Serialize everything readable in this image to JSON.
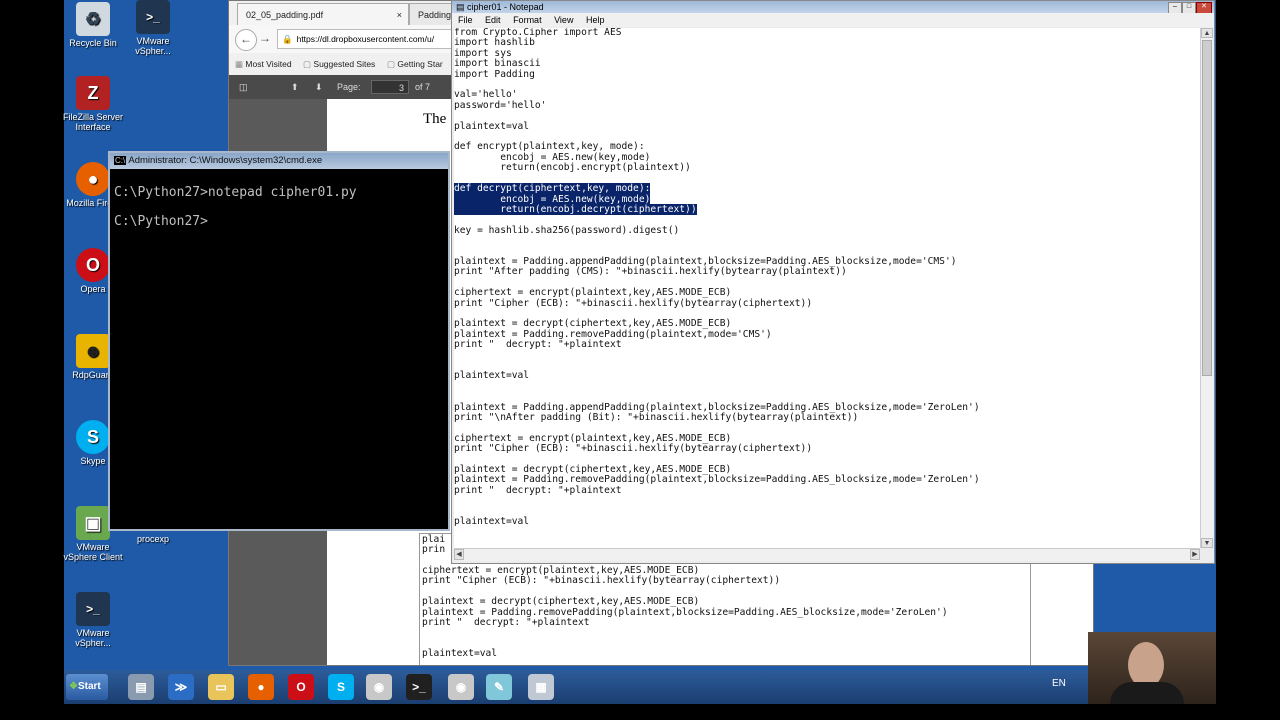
{
  "desktop": {
    "icons": [
      {
        "label": "Recycle Bin",
        "glyph": "♻",
        "color": "#d0d8e0"
      },
      {
        "label": "FileZilla Server Interface",
        "glyph": "Z",
        "color": "#b22222"
      },
      {
        "label": "Mozilla Fire...",
        "glyph": "●",
        "color": "#e66000"
      },
      {
        "label": "Opera",
        "glyph": "O",
        "color": "#cc0f16"
      },
      {
        "label": "RdpGuard",
        "glyph": "☻",
        "color": "#e8b400"
      },
      {
        "label": "Skype",
        "glyph": "S",
        "color": "#00aff0"
      },
      {
        "label": "VMware vSphere Client",
        "glyph": "▣",
        "color": "#6aa84f"
      },
      {
        "label": "VMware vSpher...",
        "glyph": ">_",
        "color": "#1f3550"
      }
    ],
    "top_icon_label": "VMware vSpher...",
    "procexp_label": "procexp"
  },
  "browser": {
    "tab1": "02_05_padding.pdf",
    "tab1_close": "×",
    "tab2": "Padding",
    "url": "https://dl.dropboxusercontent.com/u/",
    "bookmarks": [
      "Most Visited",
      "Suggested Sites",
      "Getting Star"
    ],
    "pdf_page_label": "Page:",
    "pdf_page_value": "3",
    "pdf_page_total": "of 7",
    "pdf_doc_fragment": "The",
    "pdf_code_fragment": [
      "plai",
      "prin"
    ],
    "lower_code": "ciphertext = encrypt(plaintext,key,AES.MODE_ECB)\nprint \"Cipher (ECB): \"+binascii.hexlify(bytearray(ciphertext))\n\nplaintext = decrypt(ciphertext,key,AES.MODE_ECB)\nplaintext = Padding.removePadding(plaintext,blocksize=Padding.AES_blocksize,mode='ZeroLen')\nprint \"  decrypt: \"+plaintext\n\n\nplaintext=val"
  },
  "notepad": {
    "title": "cipher01 - Notepad",
    "menu": [
      "File",
      "Edit",
      "Format",
      "View",
      "Help"
    ],
    "code_before": "from Crypto.Cipher import AES\nimport hashlib\nimport sys\nimport binascii\nimport Padding\n\nval='hello'\npassword='hello'\n\nplaintext=val\n\ndef encrypt(plaintext,key, mode):\n        encobj = AES.new(key,mode)\n        return(encobj.encrypt(plaintext))\n\n",
    "code_selected": "def decrypt(ciphertext,key, mode):\n        encobj = AES.new(key,mode)\n        return(encobj.decrypt(ciphertext))",
    "code_after": "\n\nkey = hashlib.sha256(password).digest()\n\n\nplaintext = Padding.appendPadding(plaintext,blocksize=Padding.AES_blocksize,mode='CMS')\nprint \"After padding (CMS): \"+binascii.hexlify(bytearray(plaintext))\n\nciphertext = encrypt(plaintext,key,AES.MODE_ECB)\nprint \"Cipher (ECB): \"+binascii.hexlify(bytearray(ciphertext))\n\nplaintext = decrypt(ciphertext,key,AES.MODE_ECB)\nplaintext = Padding.removePadding(plaintext,mode='CMS')\nprint \"  decrypt: \"+plaintext\n\n\nplaintext=val\n\n\nplaintext = Padding.appendPadding(plaintext,blocksize=Padding.AES_blocksize,mode='ZeroLen')\nprint \"\\nAfter padding (Bit): \"+binascii.hexlify(bytearray(plaintext))\n\nciphertext = encrypt(plaintext,key,AES.MODE_ECB)\nprint \"Cipher (ECB): \"+binascii.hexlify(bytearray(ciphertext))\n\nplaintext = decrypt(ciphertext,key,AES.MODE_ECB)\nplaintext = Padding.removePadding(plaintext,blocksize=Padding.AES_blocksize,mode='ZeroLen')\nprint \"  decrypt: \"+plaintext\n\n\nplaintext=val"
  },
  "cmd": {
    "title": "Administrator: C:\\Windows\\system32\\cmd.exe",
    "line1": "C:\\Python27>notepad cipher01.py",
    "line2": "C:\\Python27>"
  },
  "taskbar": {
    "start_label": "Start",
    "lang": "EN",
    "items": [
      {
        "name": "server-manager",
        "glyph": "▤",
        "color": "#8a9bb0"
      },
      {
        "name": "powershell",
        "glyph": "≫",
        "color": "#2b6cc4"
      },
      {
        "name": "explorer",
        "glyph": "▭",
        "color": "#e8c45a"
      },
      {
        "name": "firefox",
        "glyph": "●",
        "color": "#e66000"
      },
      {
        "name": "opera",
        "glyph": "O",
        "color": "#cc0f16"
      },
      {
        "name": "skype",
        "glyph": "S",
        "color": "#00aff0"
      },
      {
        "name": "chrome-like",
        "glyph": "◉",
        "color": "#c8c8c8"
      },
      {
        "name": "cmd",
        "glyph": ">_",
        "color": "#202020"
      },
      {
        "name": "browser-2",
        "glyph": "◉",
        "color": "#c8c8c8"
      },
      {
        "name": "notepad",
        "glyph": "✎",
        "color": "#7fc7d9"
      },
      {
        "name": "calculator",
        "glyph": "▦",
        "color": "#c0c8d4"
      }
    ]
  }
}
